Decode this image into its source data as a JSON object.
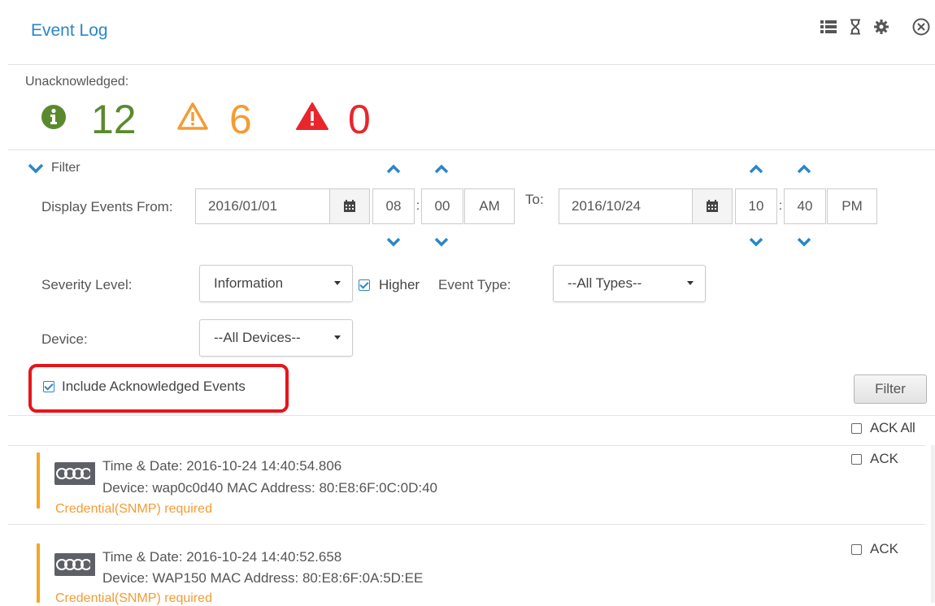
{
  "header": {
    "title": "Event Log",
    "icons": [
      "list-icon",
      "hourglass-icon",
      "gear-icon",
      "close-icon"
    ]
  },
  "unacknowledged": {
    "label": "Unacknowledged:",
    "info_count": "12",
    "warning_count": "6",
    "critical_count": "0",
    "colors": {
      "info": "#5b8a2e",
      "warning": "#f39c34",
      "critical": "#e8262b"
    }
  },
  "filter": {
    "toggle_label": "Filter",
    "from_label": "Display Events From:",
    "from_date": "2016/01/01",
    "from_hour": "08",
    "from_minute": "00",
    "from_ampm": "AM",
    "to_label": "To:",
    "to_date": "2016/10/24",
    "to_hour": "10",
    "to_minute": "40",
    "to_ampm": "PM",
    "time_separator": ":",
    "severity_label": "Severity Level:",
    "severity_value": "Information",
    "higher_label": "Higher",
    "event_type_label": "Event Type:",
    "event_type_value": "--All Types--",
    "device_label": "Device:",
    "device_value": "--All Devices--",
    "include_ack_label": "Include Acknowledged Events",
    "filter_button": "Filter"
  },
  "ack_all_label": "ACK All",
  "events": [
    {
      "time_line": "Time & Date:  2016-10-24 14:40:54.806",
      "device_line": "Device: wap0c0d40  MAC Address: 80:E8:6F:0C:0D:40",
      "message": "Credential(SNMP) required",
      "ack_label": "ACK"
    },
    {
      "time_line": "Time & Date:  2016-10-24 14:40:52.658",
      "device_line": "Device: WAP150  MAC Address: 80:E8:6F:0A:5D:EE",
      "message": "Credential(SNMP) required",
      "ack_label": "ACK"
    }
  ]
}
